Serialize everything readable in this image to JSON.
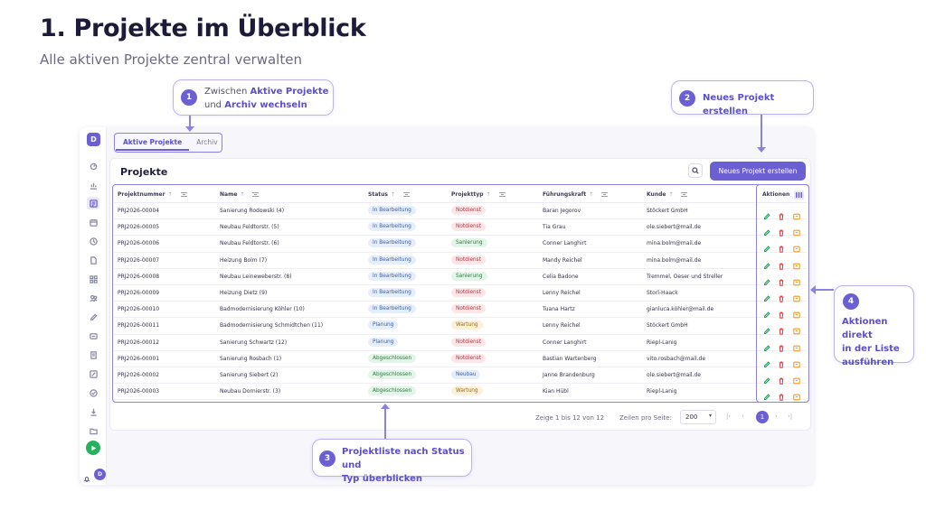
{
  "slide": {
    "title": "1. Projekte im Überblick",
    "subtitle": "Alle aktiven Projekte zentral verwalten"
  },
  "sidebar": {
    "logo": "D",
    "avatar": "D",
    "icons": [
      "dashboard-icon",
      "chart-icon",
      "projects-icon",
      "calendar-icon",
      "clock-icon",
      "document-icon",
      "grid-icon",
      "users-icon",
      "edit-icon",
      "invoice-icon",
      "file-icon",
      "report-icon",
      "check-icon",
      "download-icon",
      "folder-icon"
    ],
    "active_index": 2
  },
  "tabs": [
    {
      "label": "Aktive Projekte",
      "active": true
    },
    {
      "label": "Archiv",
      "active": false
    }
  ],
  "card": {
    "title": "Projekte",
    "new_button": "Neues Projekt erstellen"
  },
  "table": {
    "columns": [
      "Projektnummer",
      "Name",
      "Status",
      "Projekttyp",
      "Führungskraft",
      "Kunde",
      "Aktionen"
    ],
    "rows": [
      {
        "nr": "PRJ2026-00004",
        "name": "Sanierung Rodowski (4)",
        "status": "In Bearbeitung",
        "typ": "Notdienst",
        "fk": "Baran Jegorov",
        "kunde": "Stöckert GmbH"
      },
      {
        "nr": "PRJ2026-00005",
        "name": "Neubau Feldtorstr. (5)",
        "status": "In Bearbeitung",
        "typ": "Notdienst",
        "fk": "Tia Grau",
        "kunde": "ole.siebert@mail.de"
      },
      {
        "nr": "PRJ2026-00006",
        "name": "Neubau Feldtorstr. (6)",
        "status": "In Bearbeitung",
        "typ": "Sanierung",
        "fk": "Conner Langhirt",
        "kunde": "mina.bolm@mail.de"
      },
      {
        "nr": "PRJ2026-00007",
        "name": "Heizung Bolm (7)",
        "status": "In Bearbeitung",
        "typ": "Notdienst",
        "fk": "Mandy Reichel",
        "kunde": "mina.bolm@mail.de"
      },
      {
        "nr": "PRJ2026-00008",
        "name": "Neubau Leineweberstr. (8)",
        "status": "In Bearbeitung",
        "typ": "Sanierung",
        "fk": "Celia Badone",
        "kunde": "Tremmel, Oeser und Streller"
      },
      {
        "nr": "PRJ2026-00009",
        "name": "Heizung Dietz (9)",
        "status": "In Bearbeitung",
        "typ": "Notdienst",
        "fk": "Lenny Reichel",
        "kunde": "Storl-Haack"
      },
      {
        "nr": "PRJ2026-00010",
        "name": "Badmodernisierung Köhler (10)",
        "status": "In Bearbeitung",
        "typ": "Notdienst",
        "fk": "Tuana Hartz",
        "kunde": "gianluca.köhler@mail.de"
      },
      {
        "nr": "PRJ2026-00011",
        "name": "Badmodernisierung Schmidtchen (11)",
        "status": "Planung",
        "typ": "Wartung",
        "fk": "Lenny Reichel",
        "kunde": "Stöckert GmbH"
      },
      {
        "nr": "PRJ2026-00012",
        "name": "Sanierung Schwartz (12)",
        "status": "Planung",
        "typ": "Notdienst",
        "fk": "Conner Langhirt",
        "kunde": "Riepl-Lanig"
      },
      {
        "nr": "PRJ2026-00001",
        "name": "Sanierung Rosbach (1)",
        "status": "Abgeschlossen",
        "typ": "Notdienst",
        "fk": "Bastian Wartenberg",
        "kunde": "vito.rosbach@mail.de"
      },
      {
        "nr": "PRJ2026-00002",
        "name": "Sanierung Siebert (2)",
        "status": "Abgeschlossen",
        "typ": "Neubau",
        "fk": "Janne Brandenburg",
        "kunde": "ole.siebert@mail.de"
      },
      {
        "nr": "PRJ2026-00003",
        "name": "Neubau Dornierstr. (3)",
        "status": "Abgeschlossen",
        "typ": "Wartung",
        "fk": "Kian Hübl",
        "kunde": "Riepl-Lanig"
      }
    ]
  },
  "footer": {
    "range": "Zeige 1 bis 12 von 12",
    "page_size_label": "Zeilen pro Seite:",
    "page_size": "200",
    "page": "1"
  },
  "colors": {
    "accent": "#6b5fd3",
    "status": {
      "In Bearbeitung": "#e6eefc",
      "Planung": "#e6eefc",
      "Abgeschlossen": "#e6eefc"
    },
    "typ": {
      "Notdienst": "#fde6e8",
      "Sanierung": "#e3f5e8",
      "Wartung": "#fdf1dc",
      "Neubau": "#e6eefc"
    }
  },
  "callouts": {
    "c1": {
      "num": "1",
      "pre": "Zwischen ",
      "b1": "Aktive Projekte",
      "mid": "und ",
      "b2": "Archiv wechseln"
    },
    "c2": {
      "num": "2",
      "text": "Neues Projekt erstellen"
    },
    "c3": {
      "num": "3",
      "line1": "Projektliste nach Status und",
      "line2": "Typ überblicken"
    },
    "c4": {
      "num": "4",
      "line1": "Aktionen direkt",
      "line2": "in der Liste",
      "line3": "ausführen"
    }
  }
}
